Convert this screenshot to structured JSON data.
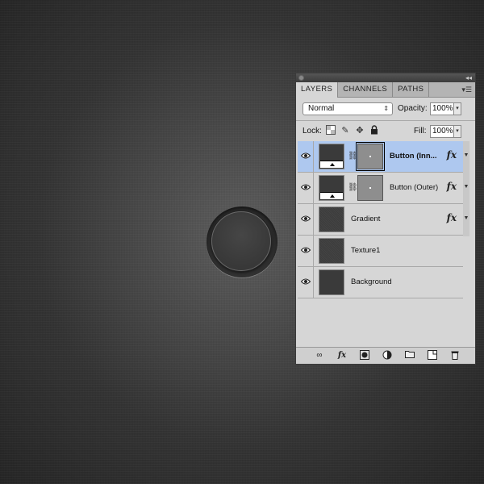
{
  "canvas": {
    "background_color": "#3a3a3a",
    "button_color": "#3a3a3a"
  },
  "panel": {
    "tabs": [
      {
        "label": "LAYERS",
        "active": true
      },
      {
        "label": "CHANNELS",
        "active": false
      },
      {
        "label": "PATHS",
        "active": false
      }
    ],
    "blend_mode": "Normal",
    "opacity_label": "Opacity:",
    "opacity_value": "100%",
    "lock_label": "Lock:",
    "fill_label": "Fill:",
    "fill_value": "100%",
    "layers": [
      {
        "name": "Button (Inn...",
        "selected": true,
        "has_mask": true,
        "has_fx": true
      },
      {
        "name": "Button (Outer)",
        "selected": false,
        "has_mask": true,
        "has_fx": true
      },
      {
        "name": "Gradient",
        "selected": false,
        "has_mask": false,
        "has_fx": true
      },
      {
        "name": "Texture1",
        "selected": false,
        "has_mask": false,
        "has_fx": false
      },
      {
        "name": "Background",
        "selected": false,
        "has_mask": false,
        "has_fx": false
      }
    ],
    "fx_symbol": "fx",
    "selection_color": "#aec8ef",
    "bottom_icons": [
      "link-layers-icon",
      "fx-icon",
      "add-mask-icon",
      "adjustment-layer-icon",
      "new-group-icon",
      "new-layer-icon",
      "trash-icon"
    ]
  }
}
